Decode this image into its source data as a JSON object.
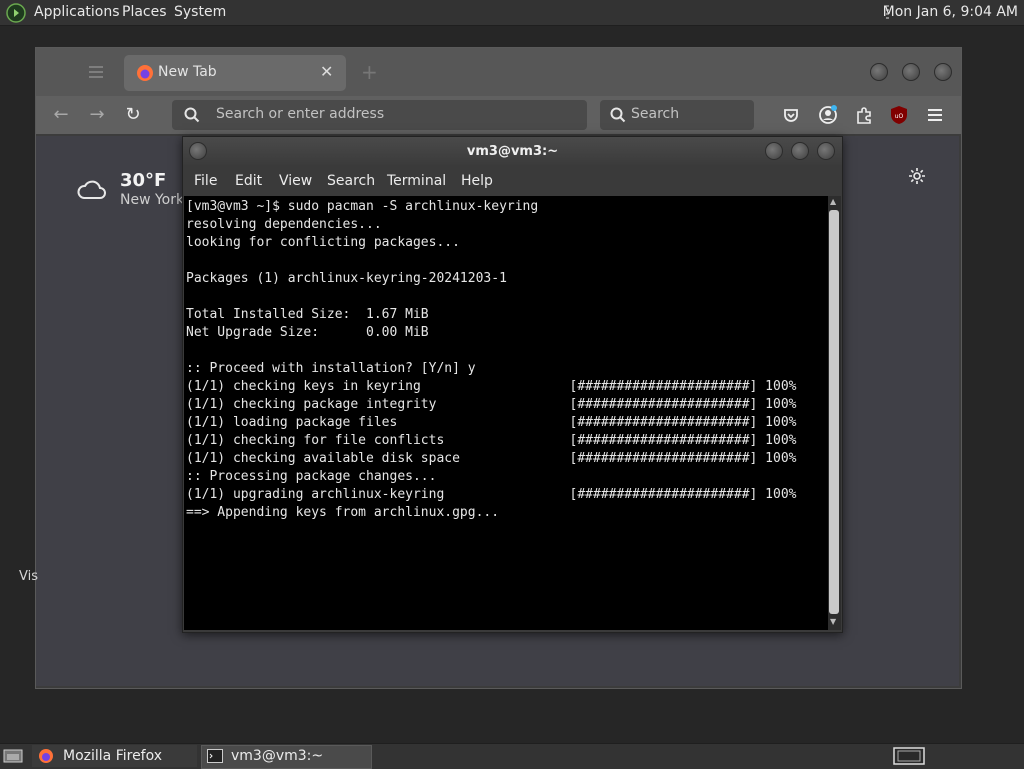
{
  "top_panel": {
    "menus": [
      "Applications",
      "Places",
      "System"
    ],
    "clock": "Mon Jan  6,  9:04 AM"
  },
  "firefox": {
    "tab_title": "New Tab",
    "address_placeholder": "Search or enter address",
    "search_placeholder": "Search",
    "weather": {
      "temp": "30°F",
      "city": "New York"
    },
    "side_text": "Vis"
  },
  "terminal": {
    "title": "vm3@vm3:~",
    "menus": [
      "File",
      "Edit",
      "View",
      "Search",
      "Terminal",
      "Help"
    ],
    "lines": [
      "[vm3@vm3 ~]$ sudo pacman -S archlinux-keyring",
      "resolving dependencies...",
      "looking for conflicting packages...",
      "",
      "Packages (1) archlinux-keyring-20241203-1",
      "",
      "Total Installed Size:  1.67 MiB",
      "Net Upgrade Size:      0.00 MiB",
      "",
      ":: Proceed with installation? [Y/n] y",
      "(1/1) checking keys in keyring                   [######################] 100%",
      "(1/1) checking package integrity                 [######################] 100%",
      "(1/1) loading package files                      [######################] 100%",
      "(1/1) checking for file conflicts                [######################] 100%",
      "(1/1) checking available disk space              [######################] 100%",
      ":: Processing package changes...",
      "(1/1) upgrading archlinux-keyring                [######################] 100%",
      "==> Appending keys from archlinux.gpg..."
    ]
  },
  "taskbar": {
    "items": [
      "Mozilla Firefox",
      "vm3@vm3:~"
    ]
  },
  "colors": {
    "panel": "#333333",
    "terminal_bg": "#000000",
    "terminal_fg": "#e6e6e6",
    "firefox_accent": "#ff7139"
  },
  "icons": [
    "arch-linux-icon",
    "back-arrow-icon",
    "forward-arrow-icon",
    "reload-icon",
    "search-icon",
    "pocket-icon",
    "account-icon",
    "extensions-icon",
    "ublock-icon",
    "hamburger-menu-icon",
    "cloud-icon",
    "gear-icon",
    "show-desktop-icon",
    "firefox-icon",
    "terminal-icon",
    "workspace-switcher-icon"
  ]
}
